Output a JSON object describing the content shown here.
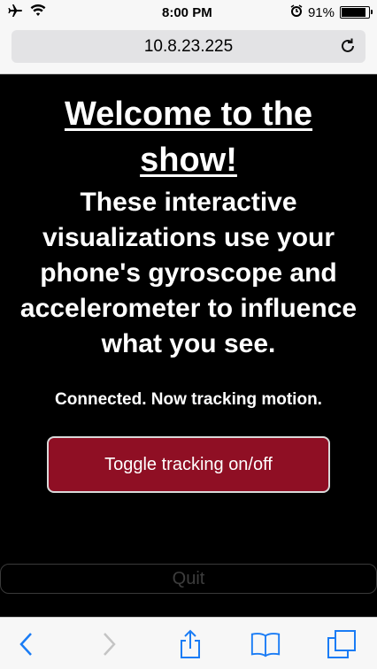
{
  "status_bar": {
    "time": "8:00 PM",
    "battery": "91%",
    "battery_level": 0.91
  },
  "browser": {
    "url": "10.8.23.225"
  },
  "page": {
    "title": "Welcome to the show!",
    "intro": "These interactive visualizations use your phone's gyroscope and accelerometer to influence what you see.",
    "status": "Connected. Now tracking motion.",
    "toggle_label": "Toggle tracking on/off",
    "quit_label": "Quit"
  },
  "colors": {
    "toggle_bg": "#8f0f24",
    "toolbar_active": "#1a7cf5",
    "toolbar_disabled": "#c4c4c4"
  }
}
